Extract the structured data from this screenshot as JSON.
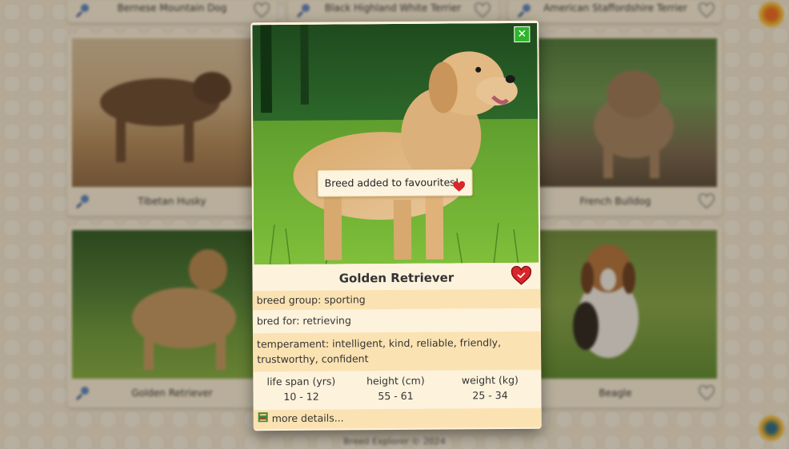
{
  "background": {
    "top_cards": [
      {
        "label": "Bernese Mountain Dog"
      },
      {
        "label": "Black Highland White Terrier"
      },
      {
        "label": "American Staffordshire Terrier"
      }
    ],
    "cards": [
      {
        "label": "Tibetan Husky"
      },
      {
        "label": "French Bulldog"
      },
      {
        "label": "Golden Retriever"
      },
      {
        "label": "Beagle"
      }
    ],
    "footer": "Breed Explorer © 2024"
  },
  "modal": {
    "breed_name": "Golden Retriever",
    "close_label": "✕",
    "toast": "Breed added to favourites!",
    "breed_group": "breed group: sporting",
    "bred_for": "bred for: retrieving",
    "temperament": "temperament: intelligent, kind, reliable, friendly, trustworthy, confident",
    "stats": [
      {
        "label": "life span (yrs)",
        "value": "10 - 12"
      },
      {
        "label": "height (cm)",
        "value": "55 - 61"
      },
      {
        "label": "weight (kg)",
        "value": "25 - 34"
      }
    ],
    "more_details": "more details..."
  },
  "colors": {
    "accent": "#2fb52a",
    "card_bg": "#fdf2dc",
    "row_tan": "#fbe2b2",
    "heart": "#d9252b"
  }
}
